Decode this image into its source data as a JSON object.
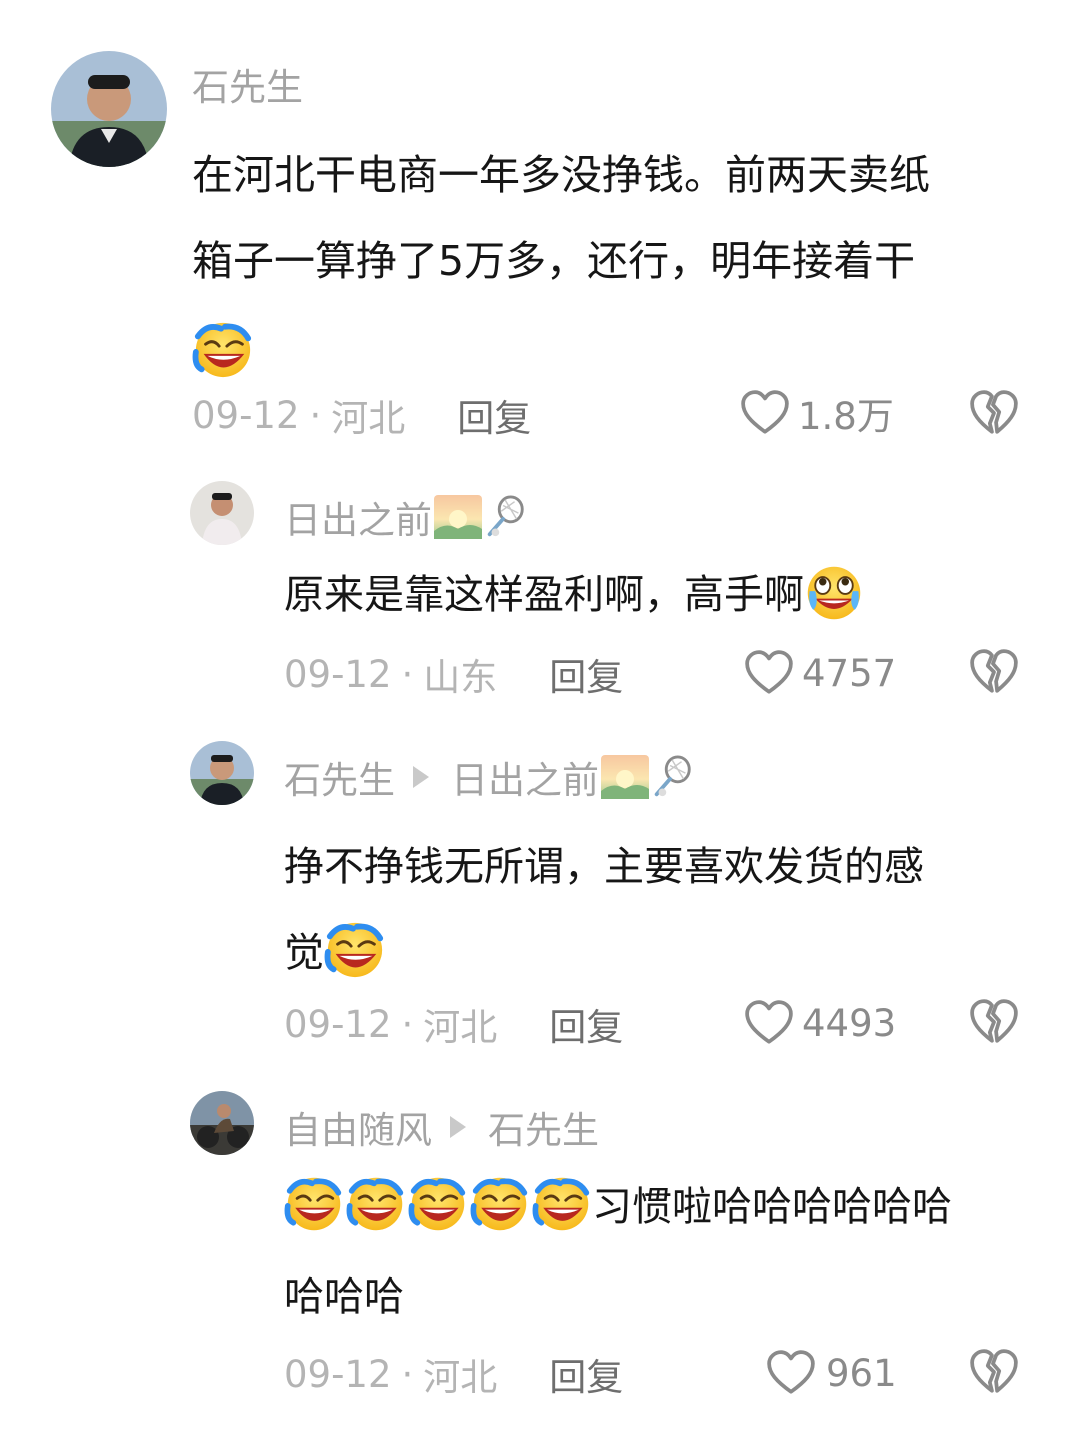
{
  "comments": [
    {
      "author": "石先生",
      "reply_to": "",
      "text_lines": [
        "在河北干电商一年多没挣钱。前两天卖纸",
        "箱子一算挣了5万多，还行，明年接着干",
        ""
      ],
      "date": "09-12",
      "location": "河北",
      "reply_label": "回复",
      "likes": "1.8万",
      "emoji": "laughing-crying"
    },
    {
      "author": "日出之前",
      "reply_to": "",
      "text_lines": [
        "原来是靠这样盈利啊，高手啊"
      ],
      "date": "09-12",
      "location": "山东",
      "reply_label": "回复",
      "likes": "4757",
      "emoji": "teary-laugh"
    },
    {
      "author": "石先生",
      "reply_to": "日出之前",
      "text_lines": [
        "挣不挣钱无所谓，主要喜欢发货的感",
        "觉"
      ],
      "date": "09-12",
      "location": "河北",
      "reply_label": "回复",
      "likes": "4493",
      "emoji": "laughing-crying"
    },
    {
      "author": "自由随风",
      "reply_to": "石先生",
      "text_lines": [
        "习惯啦哈哈哈哈哈哈",
        "哈哈哈"
      ],
      "date": "09-12",
      "location": "河北",
      "reply_label": "回复",
      "likes": "961",
      "emoji": "laughing-crying"
    }
  ],
  "separator": "·",
  "icons": {
    "like": "heart-outline-icon",
    "dislike": "broken-heart-icon",
    "author_badge": "sunrise-icon",
    "author_badge_2": "badminton-racket-icon"
  },
  "colors": {
    "text": "#161616",
    "muted": "#a3a3a3",
    "meta": "#b4b4b4",
    "reply": "#6e6e6e",
    "icon": "#8a8a8a"
  }
}
